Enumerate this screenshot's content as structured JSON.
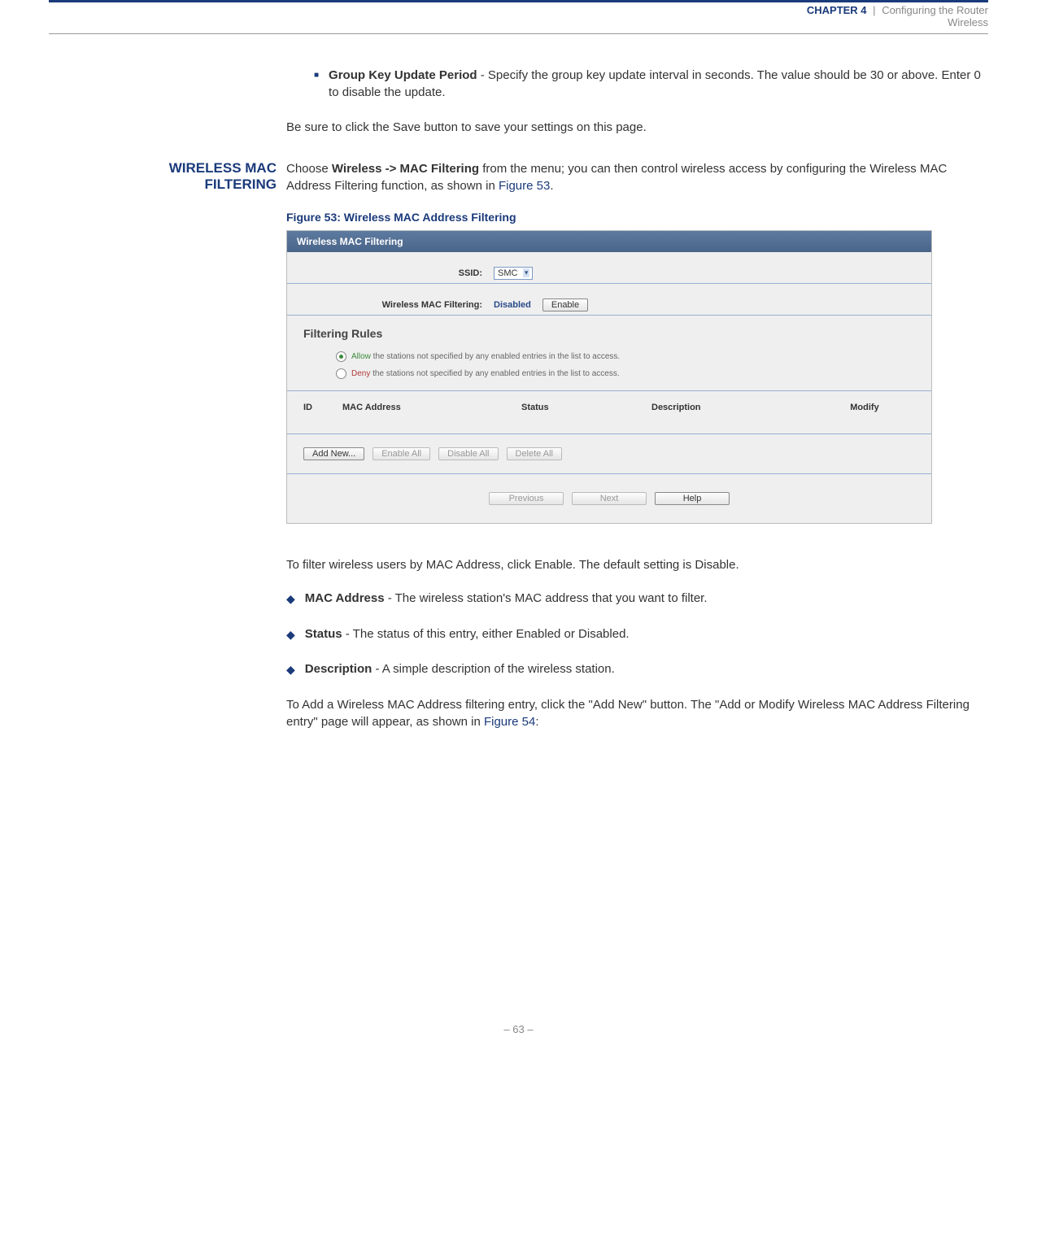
{
  "header": {
    "chapter_label": "CHAPTER 4",
    "chapter_title": "Configuring the Router",
    "subtitle": "Wireless"
  },
  "intro_bullet": {
    "term": "Group Key Update Period",
    "text_after": " - Specify the group key update interval in seconds. The value should be 30 or above. Enter 0 to disable the update."
  },
  "save_note": "Be sure to click the Save button to save your settings on this page.",
  "section": {
    "heading_line1": "WIRELESS MAC",
    "heading_line2": "FILTERING",
    "para_before": "Choose ",
    "para_bold": "Wireless -> MAC Filtering",
    "para_after1": " from the menu; you can then control wireless access by configuring the Wireless MAC Address Filtering function, as shown in ",
    "para_link": "Figure 53",
    "para_after2": "."
  },
  "figure_caption": "Figure 53:  Wireless MAC Address Filtering",
  "screenshot": {
    "title": "Wireless MAC Filtering",
    "ssid_label": "SSID:",
    "ssid_value": "SMC",
    "macf_label": "Wireless MAC Filtering:",
    "macf_status": "Disabled",
    "enable_btn": "Enable",
    "filtering_rules": "Filtering Rules",
    "allow_word": "Allow",
    "allow_rest": " the stations not specified by any enabled entries in the list to access.",
    "deny_word": "Deny",
    "deny_rest": " the stations not specified by any enabled entries in the list to access.",
    "th_id": "ID",
    "th_mac": "MAC Address",
    "th_status": "Status",
    "th_desc": "Description",
    "th_mod": "Modify",
    "add_new": "Add New...",
    "enable_all": "Enable All",
    "disable_all": "Disable All",
    "delete_all": "Delete All",
    "previous": "Previous",
    "next": "Next",
    "help": "Help"
  },
  "post_para": "To filter wireless users by MAC Address, click Enable. The default setting is Disable.",
  "bullets": [
    {
      "term": "MAC Address",
      "rest": " - The wireless station's MAC address that you want to filter."
    },
    {
      "term": "Status",
      "rest": " - The status of this entry, either Enabled or Disabled."
    },
    {
      "term": "Description",
      "rest": " - A simple description of the wireless station."
    }
  ],
  "closing": {
    "para1": "To Add a Wireless MAC Address filtering entry, click the \"Add New\" button. The \"Add or Modify Wireless MAC Address Filtering entry\" page will appear, as shown in ",
    "link": "Figure 54",
    "after": ":"
  },
  "page_number": "–  63  –"
}
